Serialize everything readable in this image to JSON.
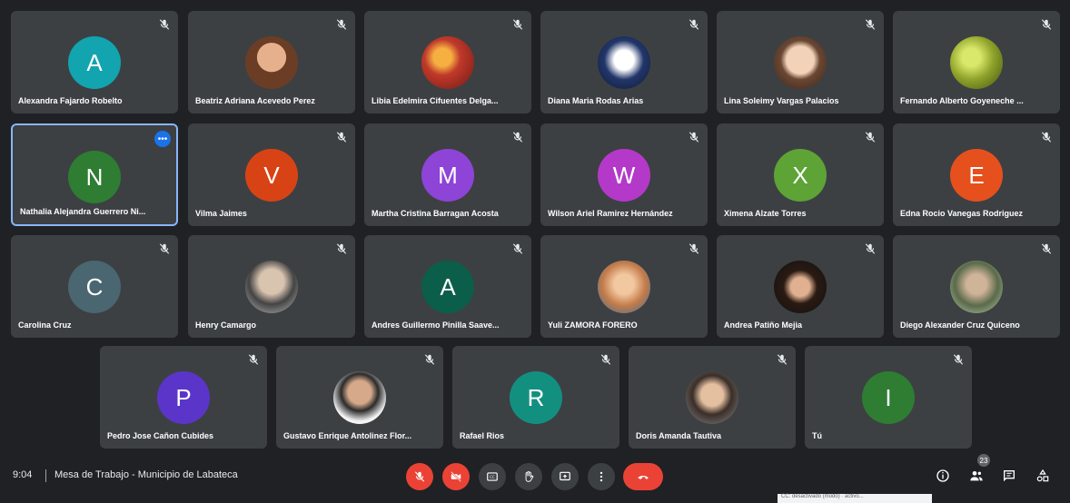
{
  "participants": [
    {
      "name": "Alexandra Fajardo Robelto",
      "initial": "A",
      "color": "#12a4af",
      "photo": null
    },
    {
      "name": "Beatriz Adriana Acevedo Perez",
      "initial": "",
      "color": "#8d5a3c",
      "photo": "portrait-warm"
    },
    {
      "name": "Libia Edelmira Cifuentes Delga...",
      "initial": "",
      "color": "#c0392b",
      "photo": "abstract-red"
    },
    {
      "name": "Diana Maria Rodas Arias",
      "initial": "",
      "color": "#2c3e70",
      "photo": "portrait-blue"
    },
    {
      "name": "Lina Soleimy Vargas Palacios",
      "initial": "",
      "color": "#b07a55",
      "photo": "portrait-light"
    },
    {
      "name": "Fernando Alberto Goyeneche ...",
      "initial": "",
      "color": "#8fa22a",
      "photo": "foliage"
    },
    {
      "name": "Nathalia Alejandra Guerrero Ni...",
      "initial": "N",
      "color": "#2e7d32",
      "photo": null
    },
    {
      "name": "Vilma Jaimes",
      "initial": "V",
      "color": "#d84315",
      "photo": null
    },
    {
      "name": "Martha Cristina Barragan Acosta",
      "initial": "M",
      "color": "#8e44d6",
      "photo": null
    },
    {
      "name": "Wilson Ariel Ramirez Hernández",
      "initial": "W",
      "color": "#b439c8",
      "photo": null
    },
    {
      "name": "Ximena Alzate Torres",
      "initial": "X",
      "color": "#5ea336",
      "photo": null
    },
    {
      "name": "Edna Rocio Vanegas Rodriguez",
      "initial": "E",
      "color": "#e6501d",
      "photo": null
    },
    {
      "name": "Carolina Cruz",
      "initial": "C",
      "color": "#4a6670",
      "photo": null
    },
    {
      "name": "Henry Camargo",
      "initial": "",
      "color": "#9a9a9a",
      "photo": "portrait-grey"
    },
    {
      "name": "Andres Guillermo Pinilla Saave...",
      "initial": "A",
      "color": "#0b5e4a",
      "photo": null
    },
    {
      "name": "Yuli ZAMORA FORERO",
      "initial": "",
      "color": "#c47b4a",
      "photo": "portrait-orange"
    },
    {
      "name": "Andrea Patiño Mejia",
      "initial": "",
      "color": "#3a2a20",
      "photo": "portrait-dark"
    },
    {
      "name": "Diego Alexander Cruz Quiceno",
      "initial": "",
      "color": "#7a8a6a",
      "photo": "portrait-green"
    },
    {
      "name": "Pedro Jose Cañon Cubides",
      "initial": "P",
      "color": "#5b35c9",
      "photo": null
    },
    {
      "name": "Gustavo Enrique Antolinez Flor...",
      "initial": "",
      "color": "#cfcfcf",
      "photo": "portrait-white"
    },
    {
      "name": "Rafael Rios",
      "initial": "R",
      "color": "#138f80",
      "photo": null
    },
    {
      "name": "Doris Amanda Tautiva",
      "initial": "",
      "color": "#6d6d6d",
      "photo": "portrait-neutral"
    },
    {
      "name": "Tú",
      "initial": "I",
      "color": "#2e7d32",
      "photo": null
    }
  ],
  "bottom_bar": {
    "time": "9:04",
    "meeting_title": "Mesa de Trabajo - Municipio de Labateca",
    "participant_count": "23",
    "tooltip_text": "CC: desactivado (modo) · activo..."
  },
  "controls": [
    "mic-off-icon",
    "camera-off-icon",
    "captions-icon",
    "raise-hand-icon",
    "present-icon",
    "more-options-icon",
    "leave-call-icon"
  ],
  "right_icons": [
    "info-icon",
    "people-icon",
    "chat-icon",
    "activities-icon"
  ]
}
